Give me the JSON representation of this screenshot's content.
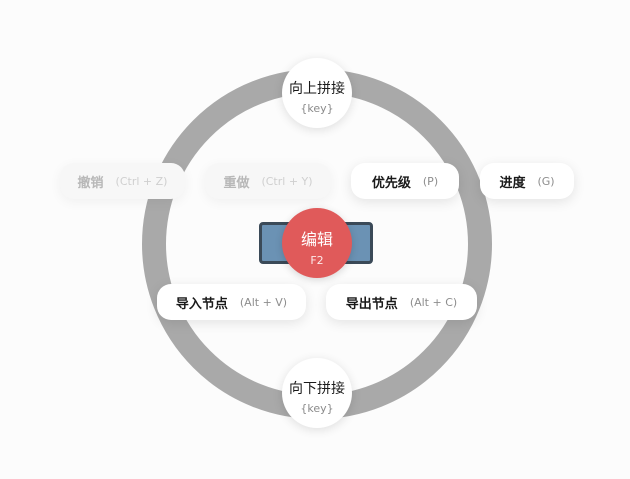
{
  "menu": {
    "up": {
      "label": "向上拼接",
      "shortcut": "{key}"
    },
    "down": {
      "label": "向下拼接",
      "shortcut": "{key}"
    },
    "center": {
      "label": "编辑",
      "shortcut": "F2"
    },
    "undo": {
      "label": "撤销",
      "shortcut": "(Ctrl + Z)",
      "enabled": false
    },
    "redo": {
      "label": "重做",
      "shortcut": "(Ctrl + Y)",
      "enabled": false
    },
    "priority": {
      "label": "优先级",
      "shortcut": "(P)",
      "enabled": true
    },
    "progress": {
      "label": "进度",
      "shortcut": "(G)",
      "enabled": true
    },
    "import_node": {
      "label": "导入节点",
      "shortcut": "(Alt + V)",
      "enabled": true
    },
    "export_node": {
      "label": "导出节点",
      "shortcut": "(Alt + C)",
      "enabled": true
    }
  },
  "colors": {
    "ring": "#a9a9a9",
    "center_button": "#e05a5a",
    "selected_node_fill": "#6b92b4",
    "selected_node_border": "#3b4a58"
  }
}
